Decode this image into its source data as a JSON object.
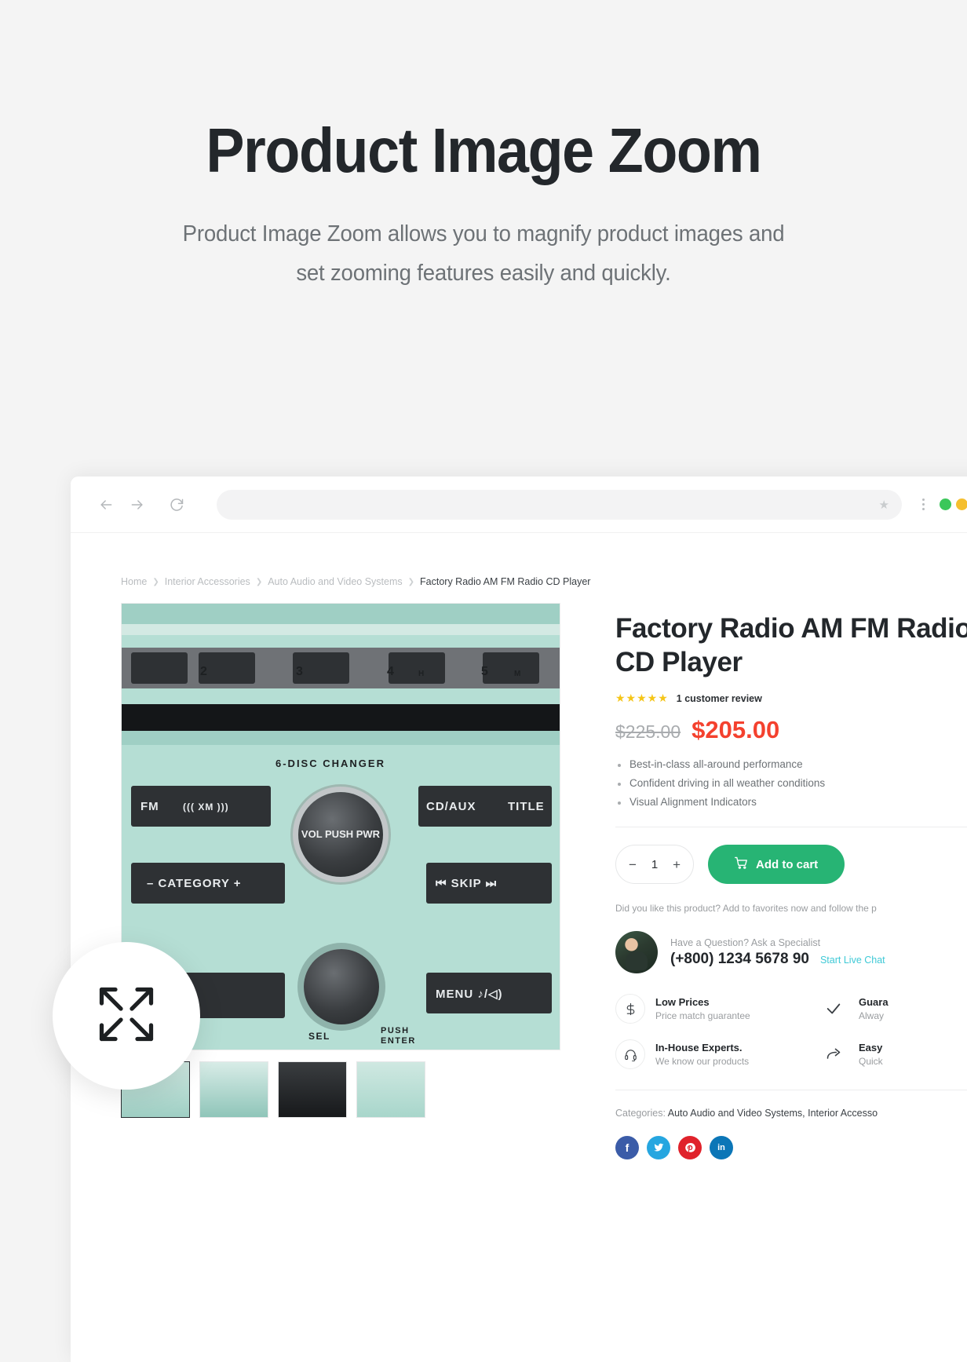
{
  "hero": {
    "title": "Product Image Zoom",
    "subtitle": "Product Image Zoom allows you to magnify product images and set zooming features easily and quickly."
  },
  "browser": {
    "url_value": "",
    "url_placeholder": "",
    "back_icon": "arrow-left-icon",
    "forward_icon": "arrow-right-icon",
    "reload_icon": "reload-icon",
    "bookmark_icon": "star-icon",
    "menu_icon": "kebab-menu-icon",
    "window_dots": [
      "#3bc75a",
      "#f5bf2f",
      "#f24b3f"
    ]
  },
  "breadcrumb": {
    "separator": "❯",
    "items": [
      {
        "label": "Home",
        "current": false
      },
      {
        "label": "Interior Accessories",
        "current": false
      },
      {
        "label": "Auto Audio and Video Systems",
        "current": false
      },
      {
        "label": "Factory Radio AM FM Radio CD Player",
        "current": true
      }
    ]
  },
  "gallery": {
    "zoom_icon": "expand-arrows-icon",
    "thumbnails": [
      {
        "name": "thumb-front-angle",
        "selected": true
      },
      {
        "name": "thumb-front",
        "selected": false
      },
      {
        "name": "thumb-side-black",
        "selected": false
      },
      {
        "name": "thumb-front-alt",
        "selected": false
      }
    ],
    "stereo": {
      "preset_numbers": [
        "2",
        "3",
        "4",
        "5"
      ],
      "preset_small": [
        "H",
        "M"
      ],
      "disc_label": "6-DISC CHANGER",
      "buttons": [
        "FM",
        "((( XM )))",
        "CD/AUX",
        "TITLE",
        "– CATEGORY +",
        "⏮ SKIP ⏭",
        "MENU ♪/◁)"
      ],
      "knob_top": "VOL\nPUSH\nPWR",
      "knob_bottom": "PUSH\nENTER",
      "sel_label": "SEL"
    }
  },
  "product": {
    "title": "Factory Radio AM FM Radio\nCD Player",
    "stars": "★★★★★",
    "review_label": "1 customer review",
    "price_old": "$225.00",
    "price_new": "$205.00",
    "features": [
      "Best-in-class all-around performance",
      "Confident driving in all weather conditions",
      "Visual Alignment Indicators"
    ],
    "qty": {
      "minus_label": "−",
      "value": "1",
      "plus_label": "+"
    },
    "add_to_cart_label": "Add to cart",
    "cart_icon": "shopping-cart-icon",
    "favorites_note": "Did you like this product? Add to favorites now and follow the p",
    "specialist": {
      "avatar": "specialist-avatar",
      "prompt": "Have a Question? Ask a Specialist",
      "phone": "(+800) 1234 5678 90",
      "chat_label": "Start Live Chat"
    },
    "badges": [
      {
        "icon": "dollar-icon",
        "title": "Low Prices",
        "sub": "Price match guarantee"
      },
      {
        "icon": "check-icon",
        "title": "Guara",
        "sub": "Alway"
      },
      {
        "icon": "headset-icon",
        "title": "In-House Experts.",
        "sub": "We know our products"
      },
      {
        "icon": "return-arrow-icon",
        "title": "Easy",
        "sub": "Quick"
      }
    ],
    "categories_label": "Categories:",
    "categories": "Auto Audio and Video Systems, Interior Accesso",
    "socials": [
      {
        "name": "facebook-share-button",
        "glyph": "f",
        "color": "#3b5ca8"
      },
      {
        "name": "twitter-share-button",
        "glyph": "ᵥ",
        "color": "#26a6e0"
      },
      {
        "name": "pinterest-share-button",
        "glyph": "р",
        "color": "#e0222b"
      },
      {
        "name": "linkedin-share-button",
        "glyph": "in",
        "color": "#0b76b7"
      }
    ]
  },
  "colors": {
    "accent_green": "#27b474",
    "price_red": "#f4412e",
    "link_cyan": "#3ec9d6",
    "star_gold": "#f5c518"
  }
}
